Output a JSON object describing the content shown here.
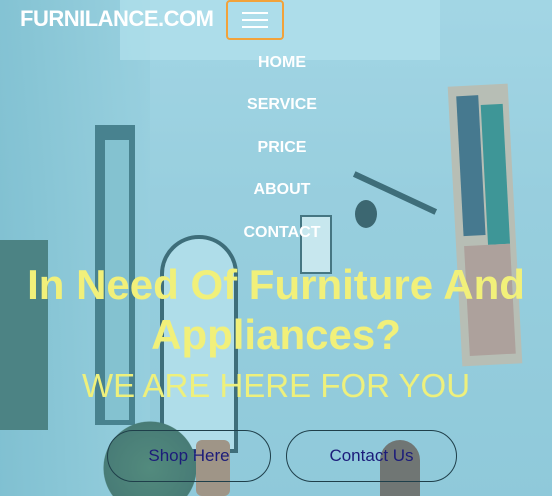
{
  "brand": {
    "name": "FURNILANCE.COM"
  },
  "nav": {
    "items": [
      {
        "label": "HOME"
      },
      {
        "label": "SERVICE"
      },
      {
        "label": "PRICE"
      },
      {
        "label": "ABOUT"
      },
      {
        "label": "CONTACT"
      }
    ]
  },
  "hero": {
    "title_line1": "In Need Of Furniture And",
    "title_line2": "Appliances?",
    "subtitle": "WE ARE HERE FOR YOU",
    "shop_button": "Shop Here",
    "contact_button": "Contact Us"
  },
  "colors": {
    "accent": "#f2a23a",
    "headline": "#f1f07a",
    "button_text": "#1c1c7a"
  }
}
